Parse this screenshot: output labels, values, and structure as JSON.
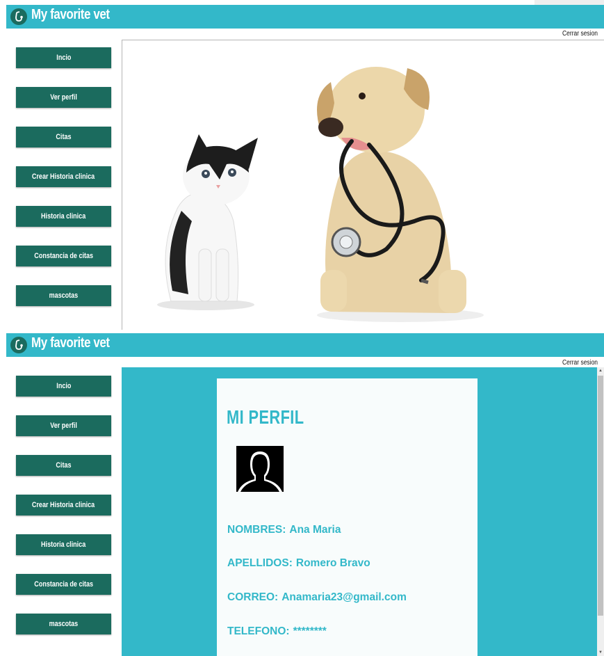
{
  "app": {
    "title": "My favorite vet",
    "logout_label": "Cerrar sesion"
  },
  "nav": {
    "items": [
      {
        "label": "Incio"
      },
      {
        "label": "Ver perfil"
      },
      {
        "label": "Citas"
      },
      {
        "label": "Crear Historia clinica"
      },
      {
        "label": "Historia clinica"
      },
      {
        "label": "Constancia de citas"
      },
      {
        "label": "mascotas"
      }
    ]
  },
  "home": {
    "image": "kitten-and-puppy-with-stethoscope"
  },
  "profile": {
    "title": "MI PERFIL",
    "fields": [
      {
        "label": "NOMBRES:",
        "value": "Ana Maria"
      },
      {
        "label": "APELLIDOS:",
        "value": "Romero Bravo"
      },
      {
        "label": "CORREO:",
        "value": "Anamaria23@gmail.com"
      },
      {
        "label": "TELEFONO:",
        "value": "********"
      }
    ]
  },
  "colors": {
    "header": "#33b8c9",
    "nav_button": "#1b6b5e",
    "accent_text": "#33b8c9"
  }
}
